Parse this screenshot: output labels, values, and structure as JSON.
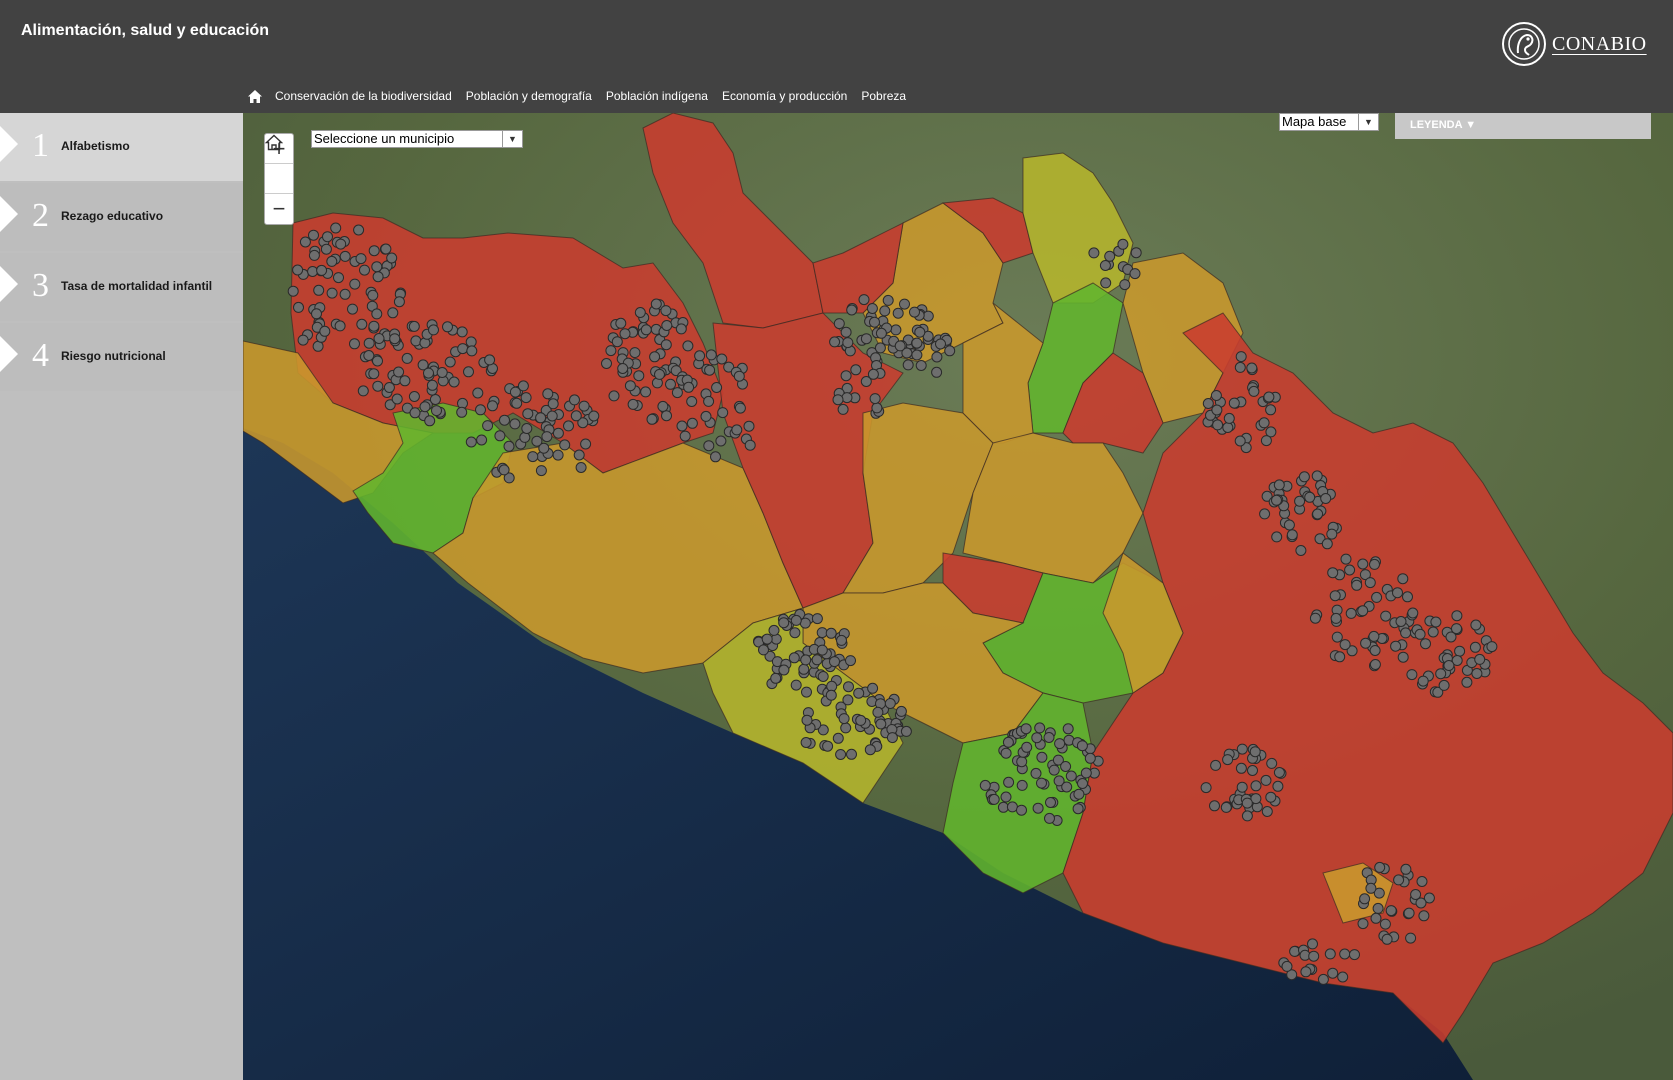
{
  "header": {
    "title": "Alimentación, salud y educación",
    "logo_text": "CONABIO",
    "nav": [
      "Conservación de la biodiversidad",
      "Población y demografía",
      "Población indígena",
      "Economía y producción",
      "Pobreza"
    ]
  },
  "sidebar": {
    "items": [
      {
        "num": "1",
        "label": "Alfabetismo",
        "active": true
      },
      {
        "num": "2",
        "label": "Rezago educativo",
        "active": false
      },
      {
        "num": "3",
        "label": "Tasa de mortalidad infantil",
        "active": false
      },
      {
        "num": "4",
        "label": "Riesgo nutricional",
        "active": false
      }
    ]
  },
  "map": {
    "municipio_placeholder": "Seleccione un municipio",
    "basemap_label": "Mapa base",
    "legend_label": "LEYENDA ▼",
    "zoom_in": "+",
    "zoom_out": "−",
    "colors": {
      "high": "#c93c2f",
      "medium": "#c9992c",
      "low": "#62b52e",
      "medium_low": "#b5b52c",
      "points": "#6e6e6e",
      "ocean": "#152a45",
      "land": "#5a6b48"
    }
  }
}
